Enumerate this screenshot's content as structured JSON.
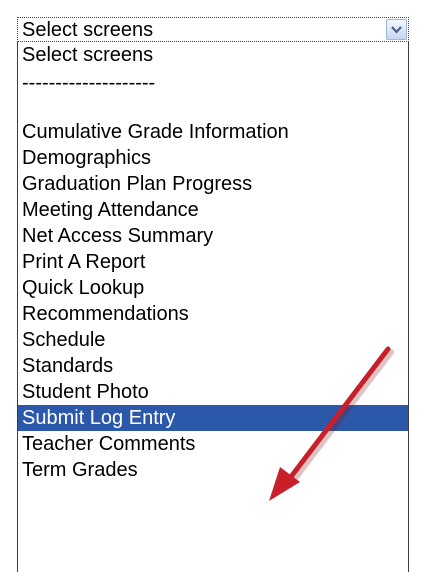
{
  "select": {
    "value": "Select screens",
    "arrow_icon": "chevron-down-icon"
  },
  "options": [
    "Select screens",
    "--------------------",
    "Cumulative Grade Information",
    "Demographics",
    "Graduation Plan Progress",
    "Meeting Attendance",
    "Net Access Summary",
    "Print A Report",
    "Quick Lookup",
    "Recommendations",
    "Schedule",
    "Standards",
    "Student Photo",
    "Submit Log Entry",
    "Teacher Comments",
    "Term Grades"
  ],
  "selected_option": "Submit Log Entry",
  "annotation": {
    "icon": "red-arrow-icon",
    "color": "#c8202a"
  },
  "colors": {
    "highlight": "#2b58a8",
    "highlight_text": "#ffffff"
  }
}
